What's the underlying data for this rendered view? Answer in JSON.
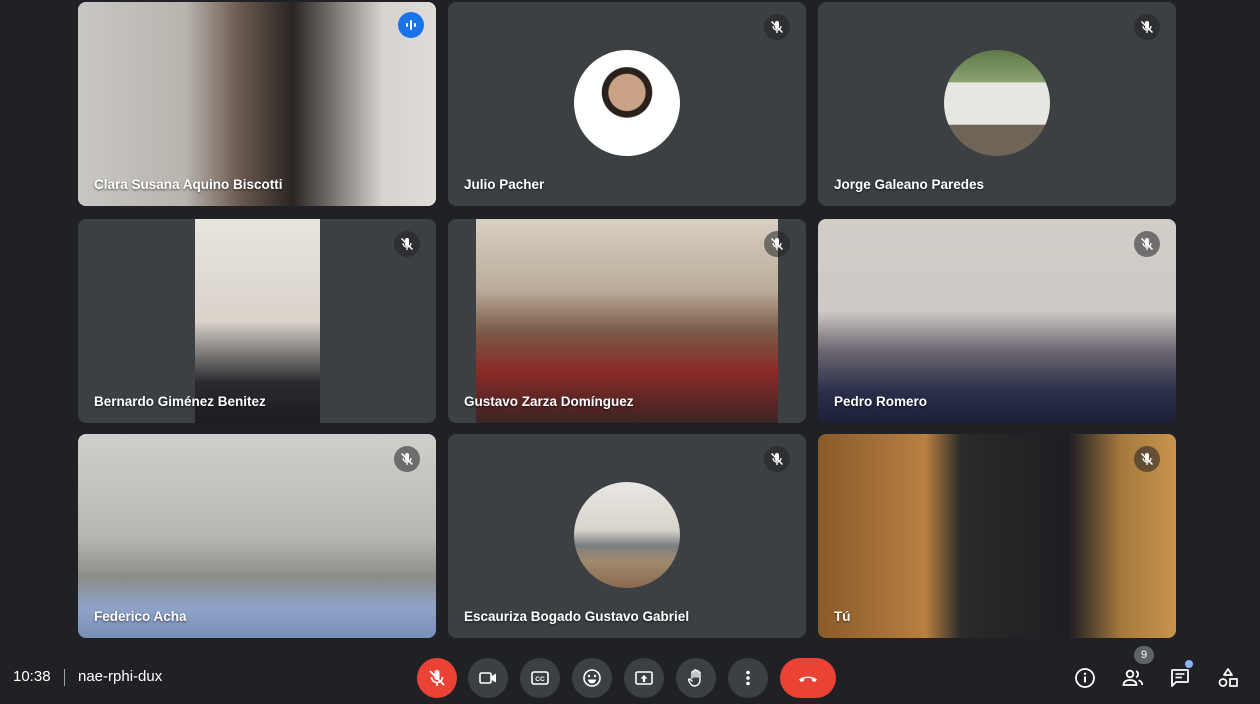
{
  "participants": [
    {
      "name": "Clara Susana Aquino Biscotti",
      "speaking": true
    },
    {
      "name": "Julio Pacher",
      "muted": true
    },
    {
      "name": "Jorge Galeano Paredes",
      "muted": true
    },
    {
      "name": "Bernardo Giménez Benitez",
      "muted": true
    },
    {
      "name": "Gustavo Zarza Domínguez",
      "muted": true
    },
    {
      "name": "Pedro Romero",
      "muted": true
    },
    {
      "name": "Federico Acha",
      "muted": true
    },
    {
      "name": "Escauriza Bogado Gustavo Gabriel",
      "muted": true
    },
    {
      "name": "Tú",
      "muted": true
    }
  ],
  "bottom_bar": {
    "time": "10:38",
    "meeting_code": "nae-rphi-dux",
    "participant_count": "9",
    "controls": [
      "microphone-off",
      "camera",
      "captions",
      "reactions",
      "present",
      "raise-hand",
      "more-options",
      "leave-call"
    ],
    "right_controls": [
      "meeting-details",
      "people",
      "chat",
      "activities"
    ]
  },
  "colors": {
    "background": "#202124",
    "tile": "#3c4043",
    "accent": "#8ab4f8",
    "danger": "#ea4335"
  }
}
